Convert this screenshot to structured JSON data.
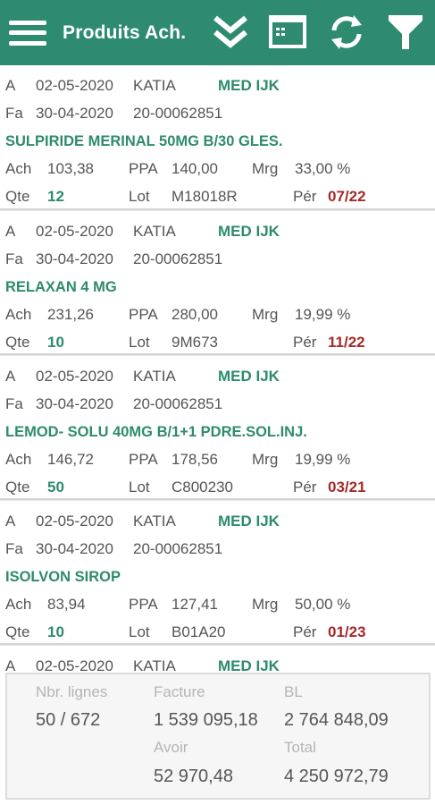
{
  "header": {
    "title": "Produits Ach.",
    "icons": [
      "menu-icon",
      "double-chevron-down-icon",
      "window-icon",
      "sync-icon",
      "filter-icon"
    ]
  },
  "labels": {
    "ach": "Ach",
    "ppa": "PPA",
    "mrg": "Mrg",
    "qte": "Qte",
    "lot": "Lot",
    "per": "Pér"
  },
  "items": [
    {
      "type": "A",
      "date": "02-05-2020",
      "user": "KATIA",
      "supplier": "MED IJK",
      "doc_type": "Fa",
      "doc_date": "30-04-2020",
      "doc_num": "20-00062851",
      "product": "SULPIRIDE MERINAL 50MG B/30 GLES.",
      "ach": "103,38",
      "ppa": "140,00",
      "mrg": "33,00 %",
      "qte": "12",
      "lot": "M18018R",
      "per": "07/22"
    },
    {
      "type": "A",
      "date": "02-05-2020",
      "user": "KATIA",
      "supplier": "MED IJK",
      "doc_type": "Fa",
      "doc_date": "30-04-2020",
      "doc_num": "20-00062851",
      "product": "RELAXAN 4 MG",
      "ach": "231,26",
      "ppa": "280,00",
      "mrg": "19,99 %",
      "qte": "10",
      "lot": "9M673",
      "per": "11/22"
    },
    {
      "type": "A",
      "date": "02-05-2020",
      "user": "KATIA",
      "supplier": "MED IJK",
      "doc_type": "Fa",
      "doc_date": "30-04-2020",
      "doc_num": "20-00062851",
      "product": "LEMOD- SOLU 40MG B/1+1 PDRE.SOL.INJ.",
      "ach": "146,72",
      "ppa": "178,56",
      "mrg": "19,99 %",
      "qte": "50",
      "lot": "C800230",
      "per": "03/21"
    },
    {
      "type": "A",
      "date": "02-05-2020",
      "user": "KATIA",
      "supplier": "MED IJK",
      "doc_type": "Fa",
      "doc_date": "30-04-2020",
      "doc_num": "20-00062851",
      "product": "ISOLVON SIROP",
      "ach": "83,94",
      "ppa": "127,41",
      "mrg": "50,00 %",
      "qte": "10",
      "lot": "B01A20",
      "per": "01/23"
    },
    {
      "type": "A",
      "date": "02-05-2020",
      "user": "KATIA",
      "supplier": "MED IJK"
    }
  ],
  "summary": {
    "nbr_lignes_label": "Nbr. lignes",
    "nbr_lignes_value": "50 / 672",
    "facture_label": "Facture",
    "facture_value": "1 539 095,18",
    "bl_label": "BL",
    "bl_value": "2 764 848,09",
    "avoir_label": "Avoir",
    "avoir_value": "52 970,48",
    "total_label": "Total",
    "total_value": "4 250 972,79"
  },
  "colors": {
    "primary": "#2e8b6f",
    "expiry": "#a52a2a"
  }
}
